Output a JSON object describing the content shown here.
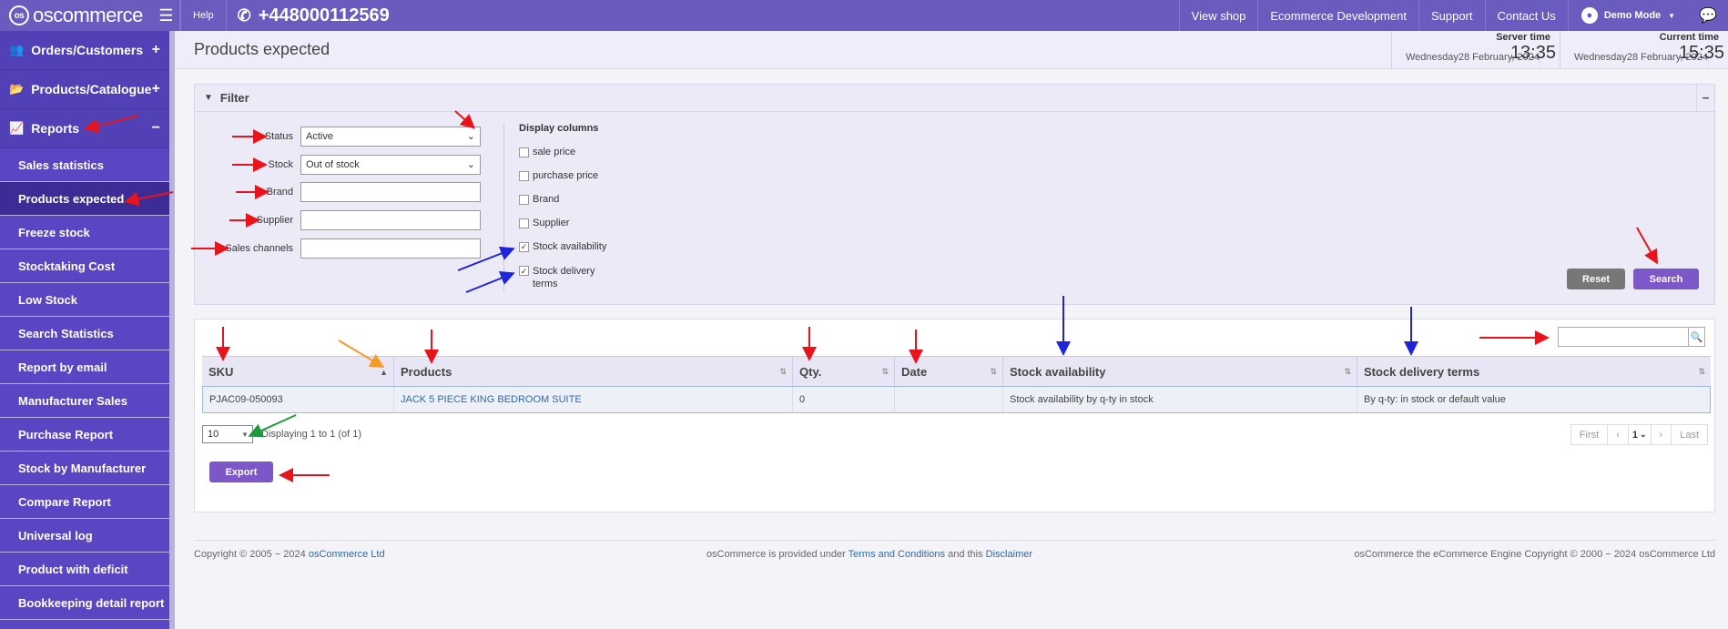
{
  "topbar": {
    "logo_text": "oscommerce",
    "help": "Help",
    "phone": "+448000112569",
    "links": [
      "View shop",
      "Ecommerce Development",
      "Support",
      "Contact Us"
    ],
    "user": "Demo Mode"
  },
  "sidebar": {
    "groups": [
      {
        "label": "Orders/Customers",
        "toggle": "+"
      },
      {
        "label": "Products/Catalogue",
        "toggle": "+"
      },
      {
        "label": "Reports",
        "toggle": "−"
      }
    ],
    "items": [
      {
        "label": "Sales statistics"
      },
      {
        "label": "Products expected"
      },
      {
        "label": "Freeze stock"
      },
      {
        "label": "Stocktaking Cost"
      },
      {
        "label": "Low Stock"
      },
      {
        "label": "Search Statistics"
      },
      {
        "label": "Report by email"
      },
      {
        "label": "Manufacturer Sales"
      },
      {
        "label": "Purchase Report"
      },
      {
        "label": "Stock by Manufacturer"
      },
      {
        "label": "Compare Report"
      },
      {
        "label": "Universal log"
      },
      {
        "label": "Product with deficit"
      },
      {
        "label": "Bookkeeping detail report"
      }
    ]
  },
  "header": {
    "title": "Products expected",
    "server_time": {
      "label": "Server time",
      "day": "Wednesday",
      "date": "28 February, 2024",
      "time": "13:35"
    },
    "current_time": {
      "label": "Current time",
      "day": "Wednesday",
      "date": "28 February, 2024",
      "time": "15:35"
    }
  },
  "filter": {
    "title": "Filter",
    "collapse": "−",
    "status_label": "Status",
    "status_value": "Active",
    "stock_label": "Stock",
    "stock_value": "Out of stock",
    "brand_label": "Brand",
    "supplier_label": "Supplier",
    "channels_label": "Sales channels",
    "display_columns_title": "Display columns",
    "columns": [
      {
        "label": "sale price",
        "checked": ""
      },
      {
        "label": "purchase price",
        "checked": ""
      },
      {
        "label": "Brand",
        "checked": ""
      },
      {
        "label": "Supplier",
        "checked": ""
      },
      {
        "label": "Stock availability",
        "checked": "✓"
      },
      {
        "label": "Stock delivery terms",
        "checked": "✓"
      }
    ],
    "reset": "Reset",
    "search": "Search"
  },
  "table": {
    "headers": [
      "SKU",
      "Products",
      "Qty.",
      "Date",
      "Stock availability",
      "Stock delivery terms"
    ],
    "rows": [
      [
        "PJAC09-050093",
        "JACK 5 PIECE KING BEDROOM SUITE",
        "0",
        "",
        "Stock availability by q-ty in stock",
        "By q-ty: in stock or default value"
      ]
    ],
    "per_page": "10",
    "info": "Displaying 1 to 1 (of 1)",
    "pager": {
      "first": "First",
      "prev": "‹",
      "page": "1",
      "next": "›",
      "last": "Last"
    },
    "export": "Export"
  },
  "footer": {
    "left_prefix": "Copyright © 2005 − 2024 ",
    "left_link": "osCommerce Ltd",
    "mid_prefix": "osCommerce is provided under ",
    "mid_link1": "Terms and Conditions",
    "mid_and": " and this ",
    "mid_link2": "Disclaimer",
    "right": "osCommerce the eCommerce Engine Copyright © 2000 − 2024 osCommerce Ltd"
  },
  "colors": {
    "brand": "#6a5bbf",
    "sidebar": "#5a46c2",
    "button": "#7b57c8",
    "arrow_red": "#e8141b",
    "arrow_blue": "#1e24d8",
    "arrow_orange": "#f39a2b",
    "arrow_green": "#1a9a3a"
  }
}
